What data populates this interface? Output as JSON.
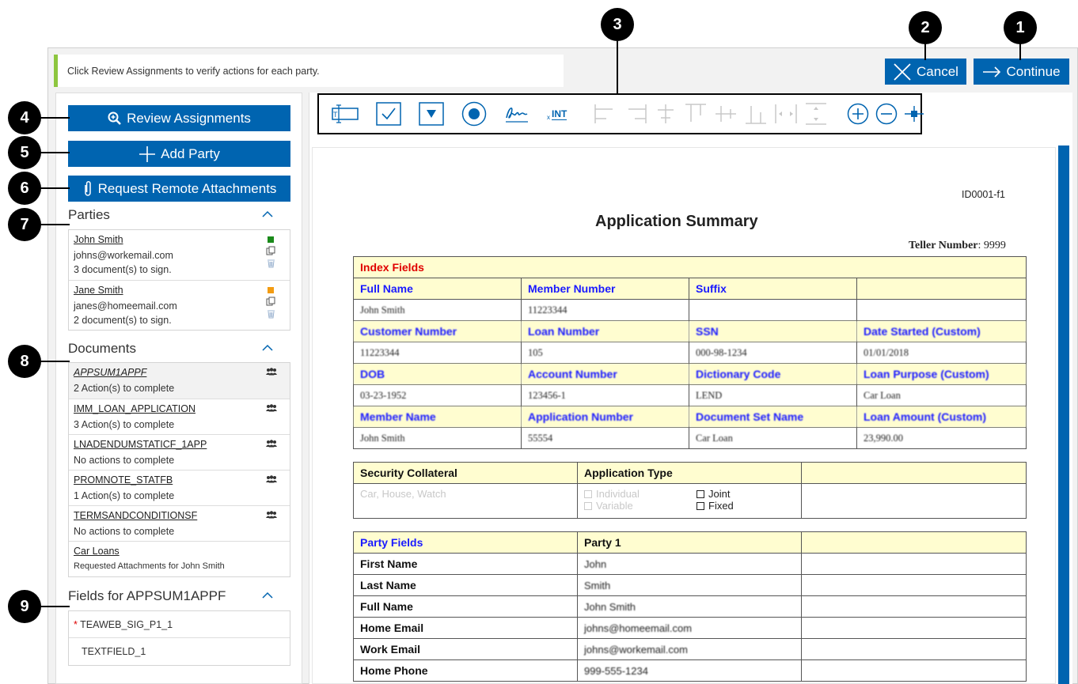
{
  "info_bar": {
    "message": "Click Review Assignments to verify actions for each party."
  },
  "header_buttons": {
    "cancel": "Cancel",
    "continue": "Continue"
  },
  "callouts": [
    "1",
    "2",
    "3",
    "4",
    "5",
    "6",
    "7",
    "8",
    "9"
  ],
  "left_buttons": {
    "review": "Review Assignments",
    "add_party": "Add Party",
    "request_attachments": "Request Remote Attachments"
  },
  "parties": {
    "title": "Parties",
    "items": [
      {
        "name": "John Smith",
        "email": "johns@workemail.com",
        "docs": "3 document(s) to sign.",
        "color": "#1a8a1a"
      },
      {
        "name": "Jane Smith",
        "email": "janes@homeemail.com",
        "docs": "2 document(s) to sign.",
        "color": "#f39c12"
      }
    ]
  },
  "documents": {
    "title": "Documents",
    "items": [
      {
        "name": "APPSUM1APPF",
        "status": "2 Action(s) to complete"
      },
      {
        "name": "IMM_LOAN_APPLICATION",
        "status": "3 Action(s) to complete"
      },
      {
        "name": "LNADENDUMSTATICF_1APP",
        "status": "No actions to complete"
      },
      {
        "name": "PROMNOTE_STATFB",
        "status": "1 Action(s) to complete"
      },
      {
        "name": "TERMSANDCONDITIONSF",
        "status": "No actions to complete"
      },
      {
        "name": "Car Loans",
        "status": "Requested Attachments for John Smith"
      }
    ]
  },
  "fields": {
    "title": "Fields for APPSUM1APPF",
    "items": [
      {
        "required_mark": "*",
        "name": "TEAWEB_SIG_P1_1"
      },
      {
        "required_mark": "",
        "name": "TEXTFIELD_1"
      }
    ]
  },
  "toolbar": {
    "tools": [
      "text-field-icon",
      "checkbox-icon",
      "dropdown-icon",
      "radio-button-icon",
      "signature-icon",
      "initials-icon",
      "align-left-icon",
      "align-right-icon",
      "align-center-icon",
      "align-top-icon",
      "align-middle-icon",
      "align-bottom-icon",
      "distribute-horizontal-icon",
      "distribute-vertical-icon",
      "zoom-in-icon",
      "zoom-out-icon",
      "fit-icon"
    ],
    "initials_label": "INT",
    "initials_prefix": "x"
  },
  "document": {
    "id": "ID0001-f1",
    "title": "Application Summary",
    "teller_label": "Teller Number",
    "teller_value": ": 9999",
    "index": {
      "title": "Index Fields",
      "rows": [
        {
          "labels": [
            "Full Name",
            "Member Number",
            "Suffix",
            ""
          ],
          "values": [
            "John Smith",
            "11223344",
            "",
            ""
          ]
        },
        {
          "labels": [
            "Customer Number",
            "Loan Number",
            "SSN",
            "Date Started (Custom)"
          ],
          "values": [
            "11223344",
            "105",
            "000-98-1234",
            "01/01/2018"
          ]
        },
        {
          "labels": [
            "DOB",
            "Account Number",
            "Dictionary Code",
            "Loan Purpose (Custom)"
          ],
          "values": [
            "03-23-1952",
            "123456-1",
            "LEND",
            "Car Loan"
          ]
        },
        {
          "labels": [
            "Member Name",
            "Application Number",
            "Document Set Name",
            "Loan Amount (Custom)"
          ],
          "values": [
            "John Smith",
            "55554",
            "Car Loan",
            "23,990.00"
          ]
        }
      ]
    },
    "security": {
      "col1": "Security Collateral",
      "col2": "Application Type",
      "placeholder": "Car, House, Watch",
      "options_faint": [
        "Individual",
        "Variable"
      ],
      "options": [
        "Joint",
        "Fixed"
      ]
    },
    "party_fields": {
      "title": "Party Fields",
      "col": "Party 1",
      "rows": [
        {
          "label": "First Name",
          "value": "John"
        },
        {
          "label": "Last Name",
          "value": "Smith"
        },
        {
          "label": "Full Name",
          "value": "John Smith"
        },
        {
          "label": "Home Email",
          "value": "johns@homeemail.com"
        },
        {
          "label": "Work Email",
          "value": "johns@workemail.com"
        },
        {
          "label": "Home Phone",
          "value": "999-555-1234"
        }
      ]
    }
  }
}
